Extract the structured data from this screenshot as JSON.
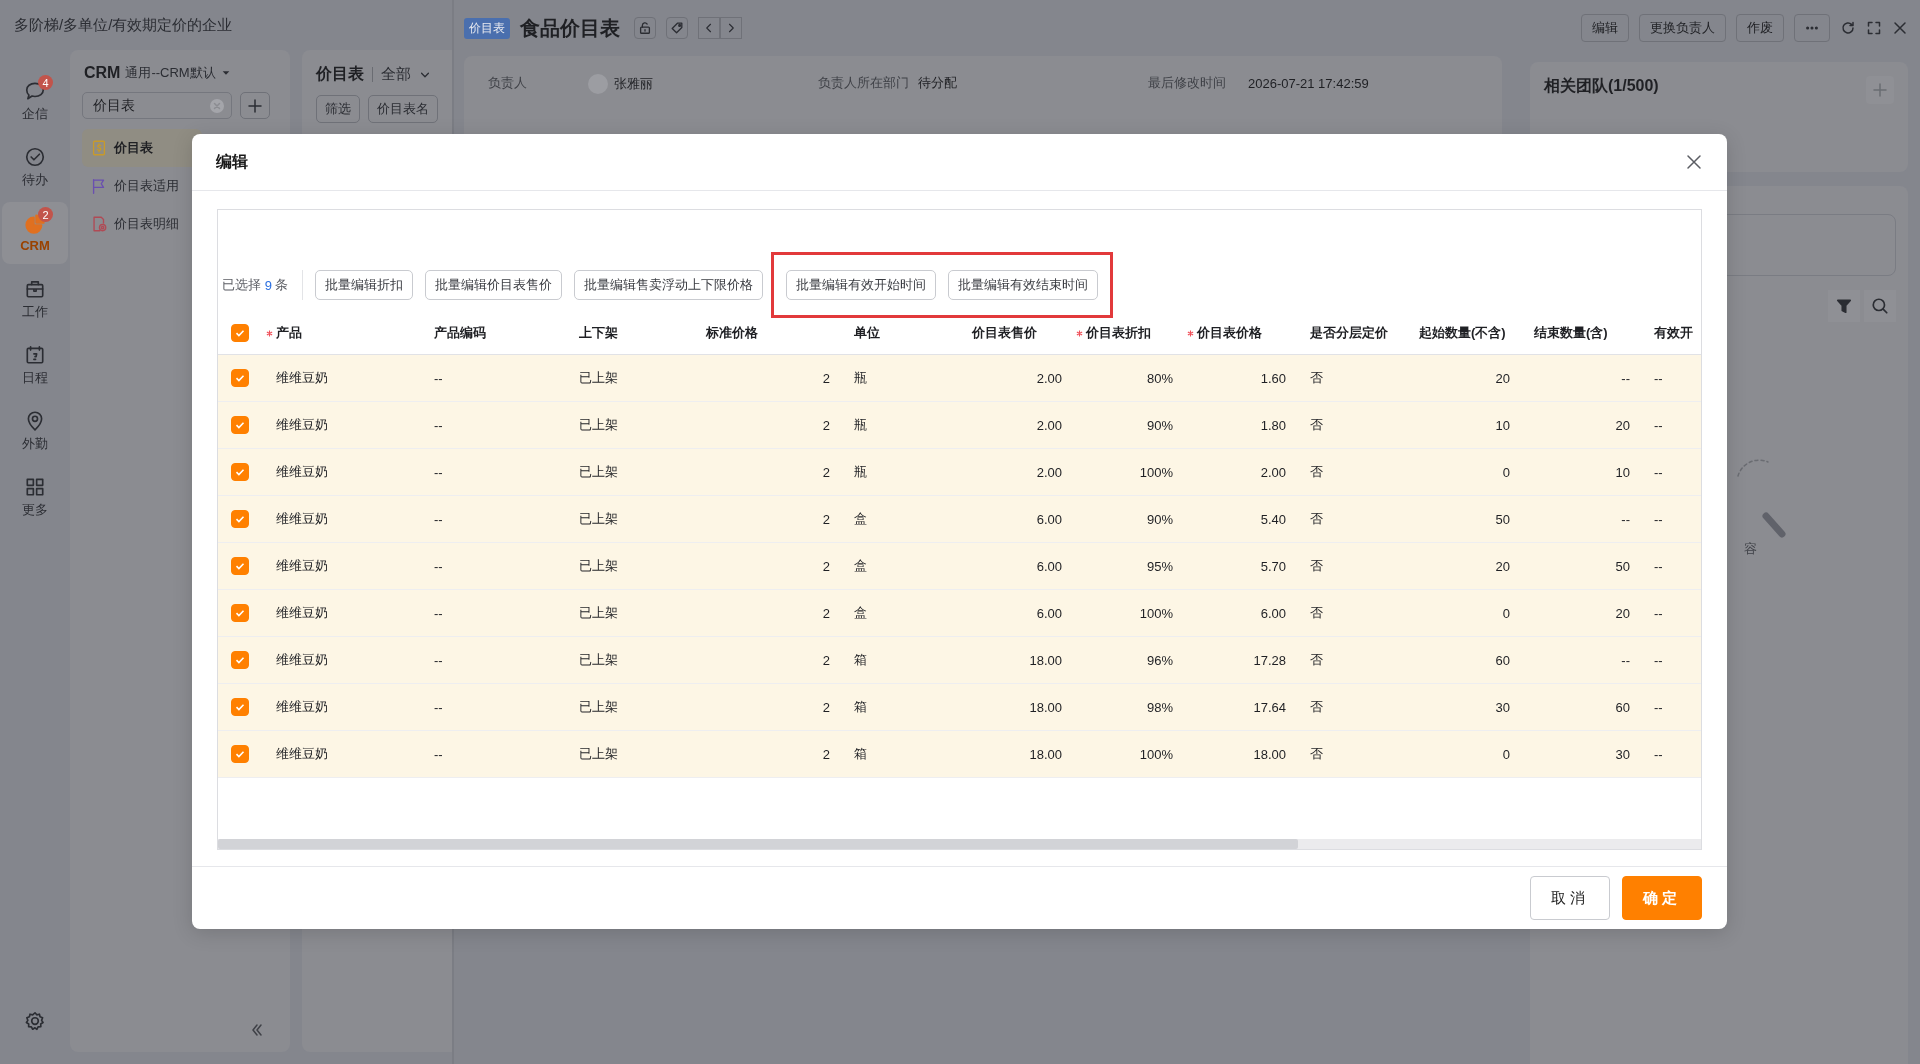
{
  "app_title": "多阶梯/多单位/有效期定价的企业",
  "rail": [
    {
      "label": "企信",
      "badge": "4",
      "selected": false
    },
    {
      "label": "待办",
      "selected": false
    },
    {
      "label": "CRM",
      "badge": "2",
      "selected": true
    },
    {
      "label": "工作",
      "selected": false
    },
    {
      "label": "日程",
      "selected": false
    },
    {
      "label": "外勤",
      "selected": false
    },
    {
      "label": "更多",
      "selected": false
    }
  ],
  "nav": {
    "title": "CRM",
    "subtitle": "通用--CRM默认",
    "search": {
      "value": "价目表"
    },
    "items": [
      {
        "label": "价目表",
        "selected": true
      },
      {
        "label": "价目表适用",
        "selected": false
      },
      {
        "label": "价目表明细",
        "selected": false
      }
    ]
  },
  "list_panel": {
    "title": "价目表",
    "scope": "全部",
    "buttons": [
      "筛选",
      "价目表名"
    ]
  },
  "detail": {
    "tag": "价目表",
    "title": "食品价目表",
    "actions": [
      "编辑",
      "更换负责人",
      "作废"
    ],
    "fields": [
      {
        "label": "负责人",
        "value": "张雅丽",
        "kind": "person"
      },
      {
        "label": "负责人所在部门",
        "value": "待分配",
        "kind": "text"
      },
      {
        "label": "最后修改时间",
        "value": "2026-07-21 17:42:59",
        "kind": "text"
      }
    ]
  },
  "team_panel": {
    "title": "相关团队(1/500)"
  },
  "empty_state": {
    "text": "容"
  },
  "dialog": {
    "title": "编辑",
    "selection": {
      "prefix": "已选择",
      "count": "9",
      "suffix": "条"
    },
    "batch_buttons": [
      "批量编辑折扣",
      "批量编辑价目表售价",
      "批量编辑售卖浮动上下限价格"
    ],
    "highlighted_buttons": [
      "批量编辑有效开始时间",
      "批量编辑有效结束时间"
    ],
    "select_all": {
      "checked": true
    },
    "columns": [
      {
        "label": "产品",
        "required": true,
        "kind": "text"
      },
      {
        "label": "产品编码",
        "required": false,
        "kind": "text"
      },
      {
        "label": "上下架",
        "required": false,
        "kind": "text"
      },
      {
        "label": "标准价格",
        "required": false,
        "kind": "number"
      },
      {
        "label": "单位",
        "required": false,
        "kind": "text"
      },
      {
        "label": "价目表售价",
        "required": false,
        "kind": "number"
      },
      {
        "label": "价目表折扣",
        "required": true,
        "kind": "number"
      },
      {
        "label": "价目表价格",
        "required": true,
        "kind": "number"
      },
      {
        "label": "是否分层定价",
        "required": false,
        "kind": "text"
      },
      {
        "label": "起始数量(不含)",
        "required": false,
        "kind": "number"
      },
      {
        "label": "结束数量(含)",
        "required": false,
        "kind": "number"
      },
      {
        "label": "有效开",
        "required": false,
        "kind": "text"
      }
    ],
    "rows": [
      {
        "selected": true,
        "cells": [
          "维维豆奶",
          "--",
          "已上架",
          "2",
          "瓶",
          "2.00",
          "80%",
          "1.60",
          "否",
          "20",
          "--",
          "--"
        ]
      },
      {
        "selected": true,
        "cells": [
          "维维豆奶",
          "--",
          "已上架",
          "2",
          "瓶",
          "2.00",
          "90%",
          "1.80",
          "否",
          "10",
          "20",
          "--"
        ]
      },
      {
        "selected": true,
        "cells": [
          "维维豆奶",
          "--",
          "已上架",
          "2",
          "瓶",
          "2.00",
          "100%",
          "2.00",
          "否",
          "0",
          "10",
          "--"
        ]
      },
      {
        "selected": true,
        "cells": [
          "维维豆奶",
          "--",
          "已上架",
          "2",
          "盒",
          "6.00",
          "90%",
          "5.40",
          "否",
          "50",
          "--",
          "--"
        ]
      },
      {
        "selected": true,
        "cells": [
          "维维豆奶",
          "--",
          "已上架",
          "2",
          "盒",
          "6.00",
          "95%",
          "5.70",
          "否",
          "20",
          "50",
          "--"
        ]
      },
      {
        "selected": true,
        "cells": [
          "维维豆奶",
          "--",
          "已上架",
          "2",
          "盒",
          "6.00",
          "100%",
          "6.00",
          "否",
          "0",
          "20",
          "--"
        ]
      },
      {
        "selected": true,
        "cells": [
          "维维豆奶",
          "--",
          "已上架",
          "2",
          "箱",
          "18.00",
          "96%",
          "17.28",
          "否",
          "60",
          "--",
          "--"
        ]
      },
      {
        "selected": true,
        "cells": [
          "维维豆奶",
          "--",
          "已上架",
          "2",
          "箱",
          "18.00",
          "98%",
          "17.64",
          "否",
          "30",
          "60",
          "--"
        ]
      },
      {
        "selected": true,
        "cells": [
          "维维豆奶",
          "--",
          "已上架",
          "2",
          "箱",
          "18.00",
          "100%",
          "18.00",
          "否",
          "0",
          "30",
          "--"
        ]
      }
    ],
    "buttons": [
      {
        "label": "取消",
        "kind": "secondary"
      },
      {
        "label": "确定",
        "kind": "primary"
      }
    ]
  }
}
